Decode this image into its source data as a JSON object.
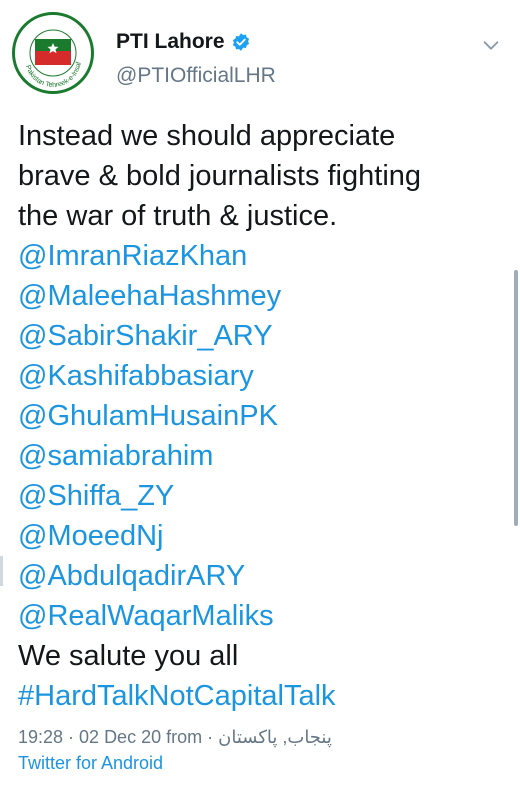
{
  "account": {
    "display_name": "PTI Lahore",
    "handle": "@PTIOfficialLHR",
    "avatar_ring_text": "Pakistan Tehreek-e-Insaf"
  },
  "tweet": {
    "text_lines": [
      "Instead we should appreciate",
      "brave & bold journalists fighting",
      "the war of truth & justice."
    ],
    "mentions": [
      "@ImranRiazKhan",
      "@MaleehaHashmey",
      "@SabirShakir_ARY",
      "@Kashifabbasiary",
      "@GhulamHusainPK",
      "@samiabrahim",
      "@Shiffa_ZY",
      "@MoeedNj",
      "@AbdulqadirARY",
      "@RealWaqarMaliks"
    ],
    "closing": "We salute you all",
    "hashtag": "#HardTalkNotCapitalTalk"
  },
  "meta": {
    "time_date": "19:28 · 02 Dec 20 from",
    "place": "پنجاب, پاکستان ·",
    "source": "Twitter for Android"
  },
  "colors": {
    "link": "#1b95e0",
    "verified": "#1da1f2",
    "secondary": "#657786"
  },
  "icons": {
    "verified": "verified-badge-icon",
    "menu": "chevron-down-icon"
  }
}
